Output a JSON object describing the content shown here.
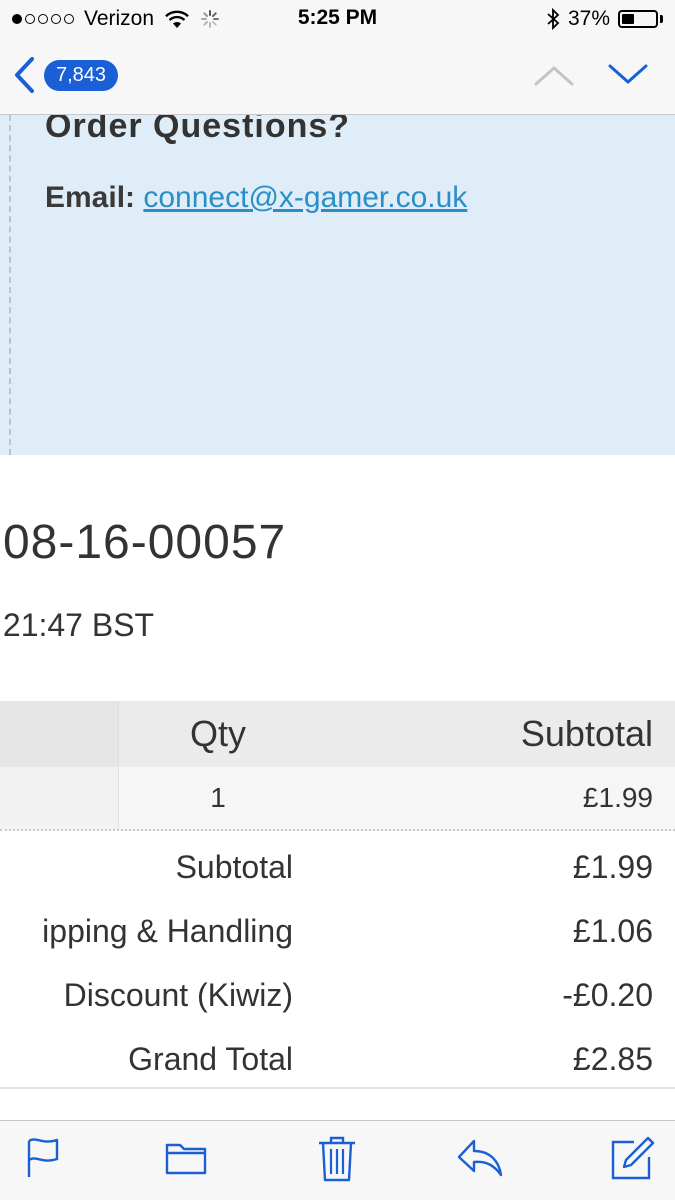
{
  "status_bar": {
    "carrier": "Verizon",
    "time": "5:25 PM",
    "battery": "37%",
    "battery_level": 0.37,
    "signal_bars": 1
  },
  "nav": {
    "back_badge": "7,843",
    "accent_color": "#1a5fd6"
  },
  "email": {
    "heading": "Order Questions?",
    "email_label": "Email:",
    "email_address": "connect@x-gamer.co.uk",
    "order_number": "-08-16-00057",
    "order_time": ":21:47 BST",
    "table": {
      "headers": [
        "Qty",
        "Subtotal"
      ],
      "rows": [
        {
          "qty": "1",
          "subtotal": "£1.99"
        }
      ]
    },
    "totals": [
      {
        "label": "Subtotal",
        "value": "£1.99"
      },
      {
        "label": "ipping & Handling",
        "value": "£1.06"
      },
      {
        "label": "Discount (Kiwiz)",
        "value": "-£0.20"
      },
      {
        "label": "Grand Total",
        "value": "£2.85"
      }
    ]
  },
  "toolbar": {
    "icons": [
      "flag-icon",
      "folder-icon",
      "trash-icon",
      "reply-icon",
      "compose-icon"
    ]
  }
}
